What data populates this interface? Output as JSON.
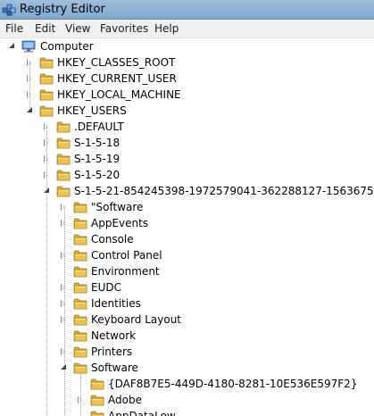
{
  "window": {
    "title": "Registry Editor"
  },
  "menu": [
    "File",
    "Edit",
    "View",
    "Favorites",
    "Help"
  ],
  "tree": {
    "root": "Computer",
    "hives": [
      "HKEY_CLASSES_ROOT",
      "HKEY_CURRENT_USER",
      "HKEY_LOCAL_MACHINE",
      "HKEY_USERS"
    ],
    "users": [
      ".DEFAULT",
      "S-1-5-18",
      "S-1-5-19",
      "S-1-5-20",
      "S-1-5-21-854245398-1972579041-362288127-1563675"
    ],
    "user_keys": [
      "\"Software",
      "AppEvents",
      "Console",
      "Control Panel",
      "Environment",
      "EUDC",
      "Identities",
      "Keyboard Layout",
      "Network",
      "Printers",
      "Software"
    ],
    "software_keys": [
      "{DAF8B7E5-449D-4180-8281-10E536E597F2}",
      "Adobe",
      "AppDataLow"
    ]
  },
  "colors": {
    "folder_body": "#e8c255",
    "folder_tab": "#d9a93a",
    "titlebar": "#8fb3d6"
  }
}
